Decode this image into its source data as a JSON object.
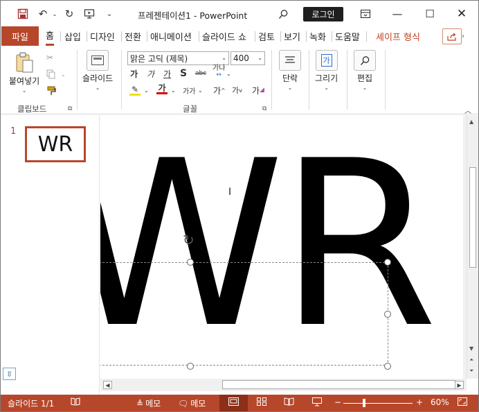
{
  "title_bar": {
    "title": "프레젠테이션1  -  PowerPoint",
    "login_label": "로그인",
    "icons": [
      "save-icon",
      "undo-icon",
      "redo-icon",
      "present-icon",
      "customize-icon",
      "search-icon",
      "ribbon-display-icon",
      "minimize-icon",
      "maximize-icon",
      "close-icon"
    ]
  },
  "tabs": {
    "file": "파일",
    "home": "홈",
    "insert": "삽입",
    "design": "디자인",
    "transitions": "전환",
    "animations": "애니메이션",
    "slideshow": "슬라이드 쇼",
    "review": "검토",
    "view": "보기",
    "record": "녹화",
    "help": "도움말",
    "shape_format": "셰이프 형식"
  },
  "ribbon": {
    "clipboard": {
      "paste": "붙여넣기",
      "group": "클립보드"
    },
    "slides": {
      "slide": "슬라이드"
    },
    "font": {
      "font_name": "맑은 고딕 (제목)",
      "font_size": "400",
      "bold": "가",
      "italic": "가",
      "underline": "가",
      "strike_s": "S",
      "strikethrough": "abc",
      "spacing": "가나",
      "font_color": "가",
      "case": "가가",
      "grow": "가",
      "shrink": "가",
      "clear": "가",
      "group": "글꼴"
    },
    "paragraph": {
      "label": "단락"
    },
    "drawing": {
      "label": "그리기",
      "icon_text": "가"
    },
    "editing": {
      "label": "편집"
    }
  },
  "thumbnails": [
    {
      "number": "1",
      "text": "WR"
    }
  ],
  "slide": {
    "text": "WR"
  },
  "status_bar": {
    "slide_info": "슬라이드 1/1",
    "notes": "메모",
    "comments": "메모",
    "zoom": "60%",
    "zoom_minus": "−",
    "zoom_plus": "+"
  },
  "colors": {
    "accent": "#b7472a",
    "status_active": "#8c2f19"
  }
}
